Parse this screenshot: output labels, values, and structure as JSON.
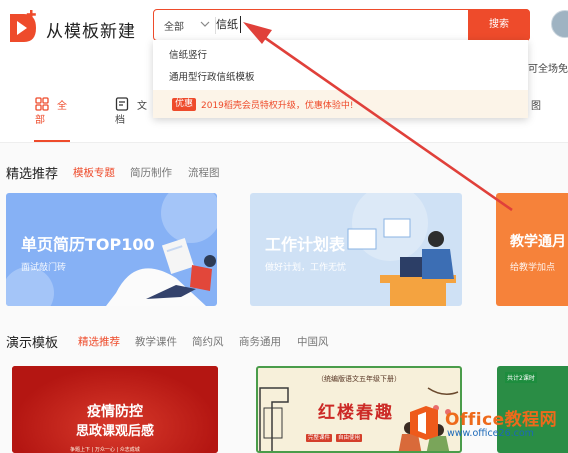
{
  "header": {
    "brand": "从模板新建",
    "search": {
      "category": "全部",
      "query": "信纸",
      "button": "搜索"
    },
    "promo_right": "可全场免费"
  },
  "dropdown": {
    "suggestions": [
      "信纸竖行",
      "通用型行政信纸模板"
    ],
    "promo_badge": "优惠",
    "promo_text": "2019稻壳会员特权升级，优惠体验中!"
  },
  "categories": {
    "all_label_1": "全",
    "all_label_2": "部",
    "doc_label_1": "文",
    "doc_label_2": "档",
    "image_label": "图"
  },
  "featured": {
    "title": "精选推荐",
    "tabs": [
      "模板专题",
      "简历制作",
      "流程图"
    ],
    "banners": [
      {
        "title": "单页简历TOP100",
        "subtitle": "面试敲门砖",
        "color": "#86b1f5"
      },
      {
        "title": "工作计划表",
        "subtitle": "做好计划，工作无忧",
        "color": "#cfe1f5"
      },
      {
        "title": "教学通月",
        "subtitle": "给教学加点",
        "color": "#f6823a"
      }
    ]
  },
  "presentations": {
    "title": "演示模板",
    "tabs": [
      "精选推荐",
      "教学课件",
      "简约风",
      "商务通用",
      "中国风"
    ],
    "cards": [
      {
        "title_1": "疫情防控",
        "title_2": "思政课观后感",
        "subtitle": "争题上下 | 万众一心 | 众志成城"
      },
      {
        "top": "（统编版语文五年级下册）",
        "title": "红楼春趣",
        "button_1": "完整课件",
        "button_2": "自由使用"
      },
      {
        "tag": "共计2课时"
      }
    ]
  },
  "watermark": {
    "text": "Office教程网",
    "url": "www.office26.com"
  },
  "colors": {
    "accent": "#ee4b2b",
    "promo_bg": "#fcf4e8"
  }
}
